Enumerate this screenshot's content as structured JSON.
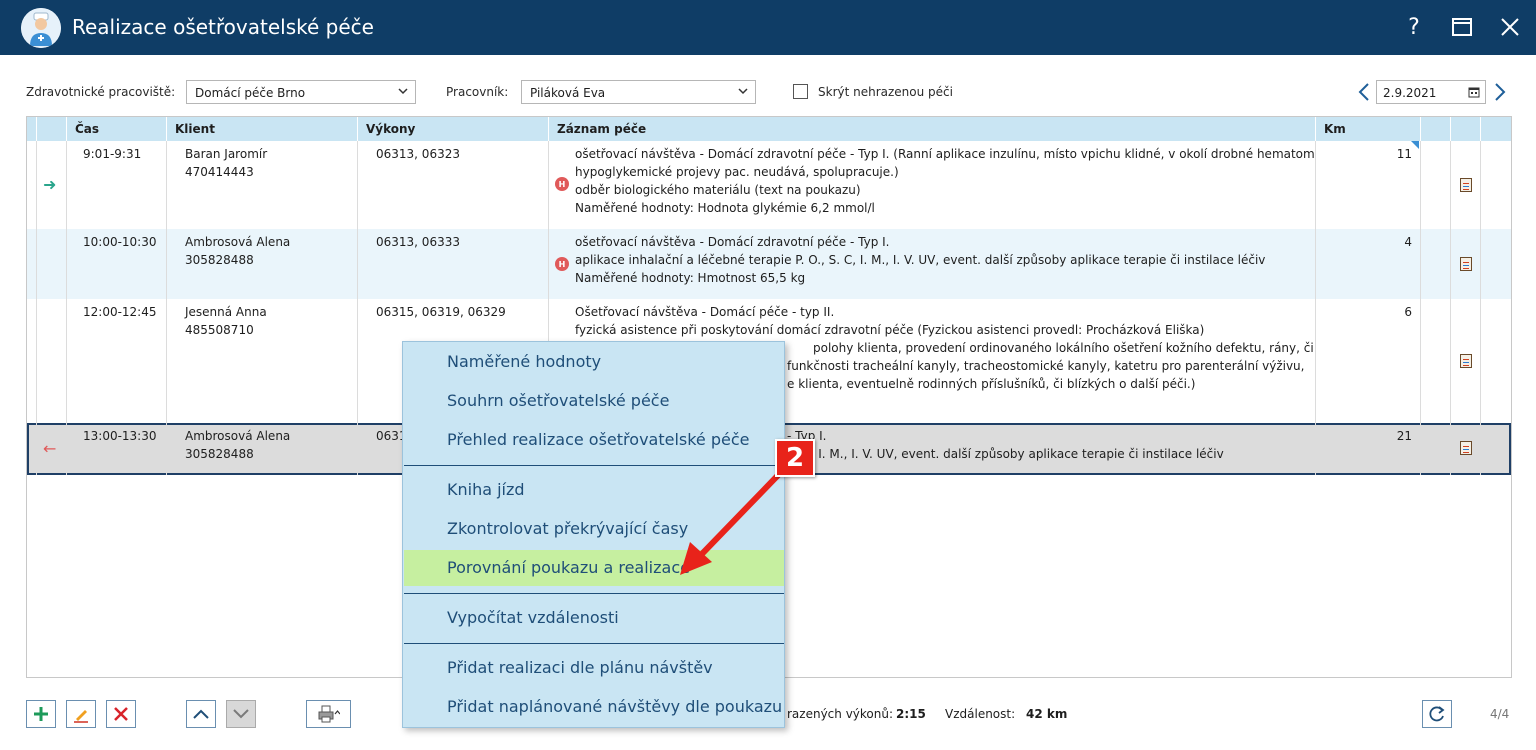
{
  "window": {
    "title": "Realizace ošetřovatelské péče",
    "help": "?"
  },
  "toolbar": {
    "workplace_label": "Zdravotnické pracoviště:",
    "workplace_value": "Domácí péče Brno",
    "worker_label": "Pracovník:",
    "worker_value": "Piláková Eva",
    "hide_label": "Skrýt nehrazenou péči",
    "date": "2.9.2021"
  },
  "columns": [
    "Čas",
    "Klient",
    "Výkony",
    "Záznam péče",
    "Km"
  ],
  "rows": [
    {
      "time": "9:01-9:31",
      "client_name": "Baran Jaromír",
      "client_id": "470414443",
      "codes": "06313, 06323",
      "notes": [
        "ošetřovací návštěva - Domácí zdravotní péče - Typ I. (Ranní aplikace inzulínu, místo vpichu klidné, v okolí drobné hematomy,",
        "hypoglykemické projevy pac. neudává, spolupracuje.)",
        "odběr biologického materiálu (text na poukazu)",
        "Naměřené hodnoty: Hodnota glykémie 6,2 mmol/l"
      ],
      "km": "11",
      "icon": "arrow-right-icon"
    },
    {
      "time": "10:00-10:30",
      "client_name": "Ambrosová Alena",
      "client_id": "305828488",
      "codes": "06313, 06333",
      "notes": [
        "ošetřovací návštěva - Domácí zdravotní péče - Typ I.",
        "aplikace inhalační a léčebné terapie P. O., S. C, I. M., I. V. UV, event. další způsoby aplikace terapie či instilace léčiv",
        "Naměřené hodnoty: Hmotnost 65,5 kg"
      ],
      "km": "4",
      "icon": ""
    },
    {
      "time": "12:00-12:45",
      "client_name": "Jesenná Anna",
      "client_id": "485508710",
      "codes": "06315, 06319, 06329",
      "notes": [
        "Ošetřovací návštěva - Domácí péče - typ II.",
        "fyzická asistence při poskytování domácí zdravotní péče (Fyzickou asistenci provedl: Procházková Eliška)",
        "polohy klienta, provedení ordinovaného lokálního ošetření kožního defektu, rány, či",
        "funkčnosti tracheální kanyly, tracheostomické kanyly, katetru pro parenterální výživu,",
        "e klienta, eventuelně rodinných příslušníků, či blízkých o další péči.)"
      ],
      "km": "6",
      "icon": ""
    },
    {
      "time": "13:00-13:30",
      "client_name": "Ambrosová Alena",
      "client_id": "305828488",
      "codes": "0631",
      "notes": [
        "- Typ I.",
        "S. C, I. M., I. V. UV, event. další způsoby aplikace terapie či instilace léčiv"
      ],
      "km": "21",
      "icon": "arrow-left-icon"
    }
  ],
  "heart_letter": "H",
  "status": {
    "time_label": "razených výkonů:",
    "time_value": "2:15",
    "distance_label": "Vzdálenost:",
    "distance_value": "42 km",
    "page": "4/4"
  },
  "menu": {
    "items": [
      "Naměřené hodnoty",
      "Souhrn ošetřovatelské péče",
      "Přehled realizace ošetřovatelské péče",
      "Kniha jízd",
      "Zkontrolovat překrývající časy",
      "Porovnání poukazu a realizace",
      "Vypočítat vzdálenosti",
      "Přidat realizaci dle plánu návštěv",
      "Přidat naplánované návštěvy dle poukazu"
    ]
  },
  "annotation": {
    "badge": "2",
    "color": "#e8231a"
  },
  "colors": {
    "titlebar": "#0f3d66",
    "header": "#c9e5f3",
    "menu_highlight": "#c6efa0",
    "row_alt": "#eaf5fb",
    "row_selected": "#dcdcdc"
  }
}
